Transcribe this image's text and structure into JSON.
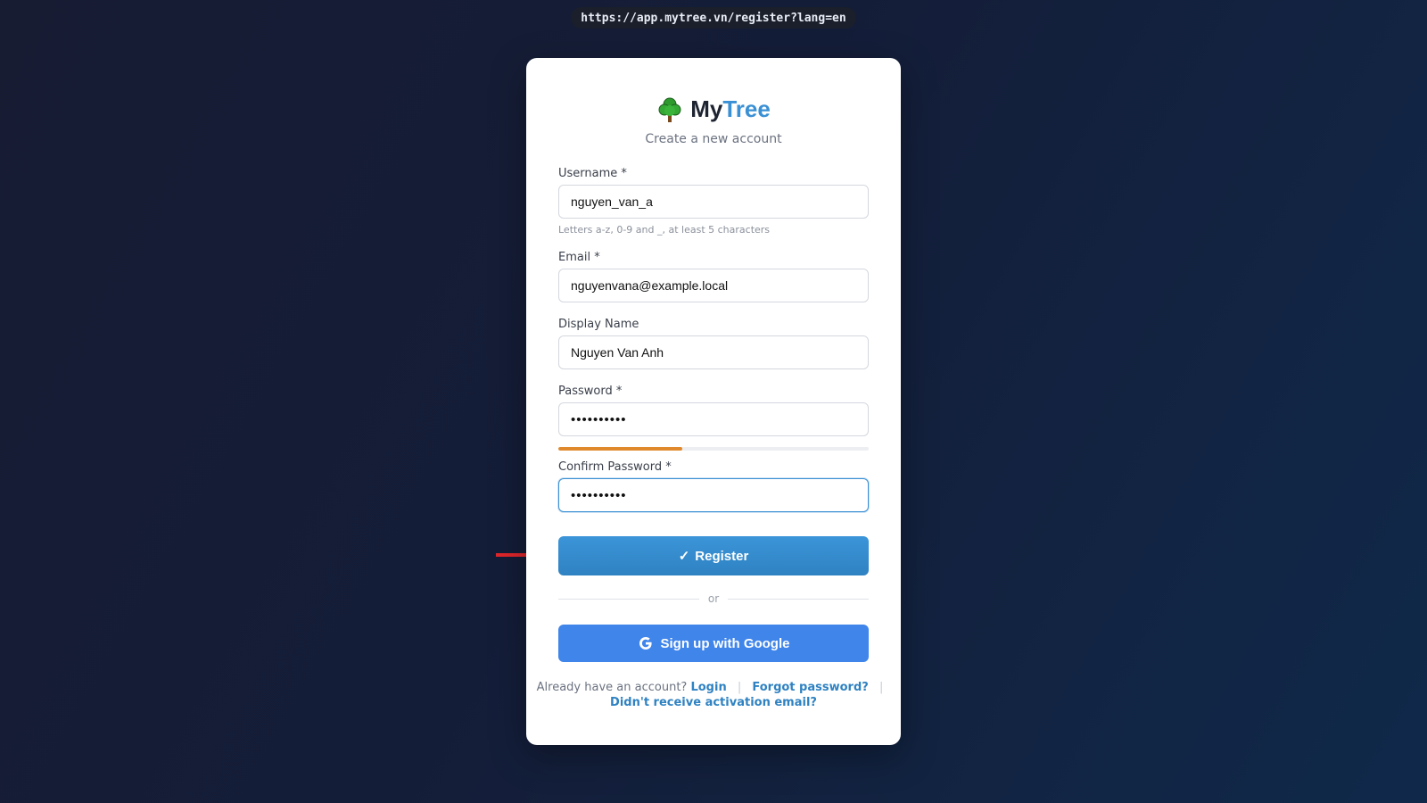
{
  "browser": {
    "url": "https://app.mytree.vn/register?lang=en"
  },
  "brand": {
    "name_part1": "My",
    "name_part2": "Tree",
    "subtitle": "Create a new account"
  },
  "form": {
    "username": {
      "label": "Username *",
      "value": "nguyen_van_a",
      "hint": "Letters a-z, 0-9 and _, at least 5 characters"
    },
    "email": {
      "label": "Email *",
      "value": "nguyenvana@example.local"
    },
    "display_name": {
      "label": "Display Name",
      "value": "Nguyen Van Anh"
    },
    "password": {
      "label": "Password *",
      "value": "••••••••••",
      "strength_fraction": 0.4,
      "strength_color": "#e0892c"
    },
    "confirm_password": {
      "label": "Confirm Password *",
      "value": "••••••••••"
    }
  },
  "actions": {
    "register_icon": "✓",
    "register_label": "Register",
    "divider_text": "or",
    "google_label": "Sign up with Google"
  },
  "footer": {
    "already_text": "Already have an account?",
    "login_label": "Login",
    "forgot_label": "Forgot password?",
    "resend_label": "Didn't receive activation email?",
    "separator": "|"
  },
  "colors": {
    "accent": "#3a90d4",
    "google_blue": "#3f85ea",
    "arrow_red": "#e0262b"
  },
  "icons": {
    "logo": "tree-icon",
    "google": "google-g-icon",
    "pointer": "red-arrow-icon"
  }
}
